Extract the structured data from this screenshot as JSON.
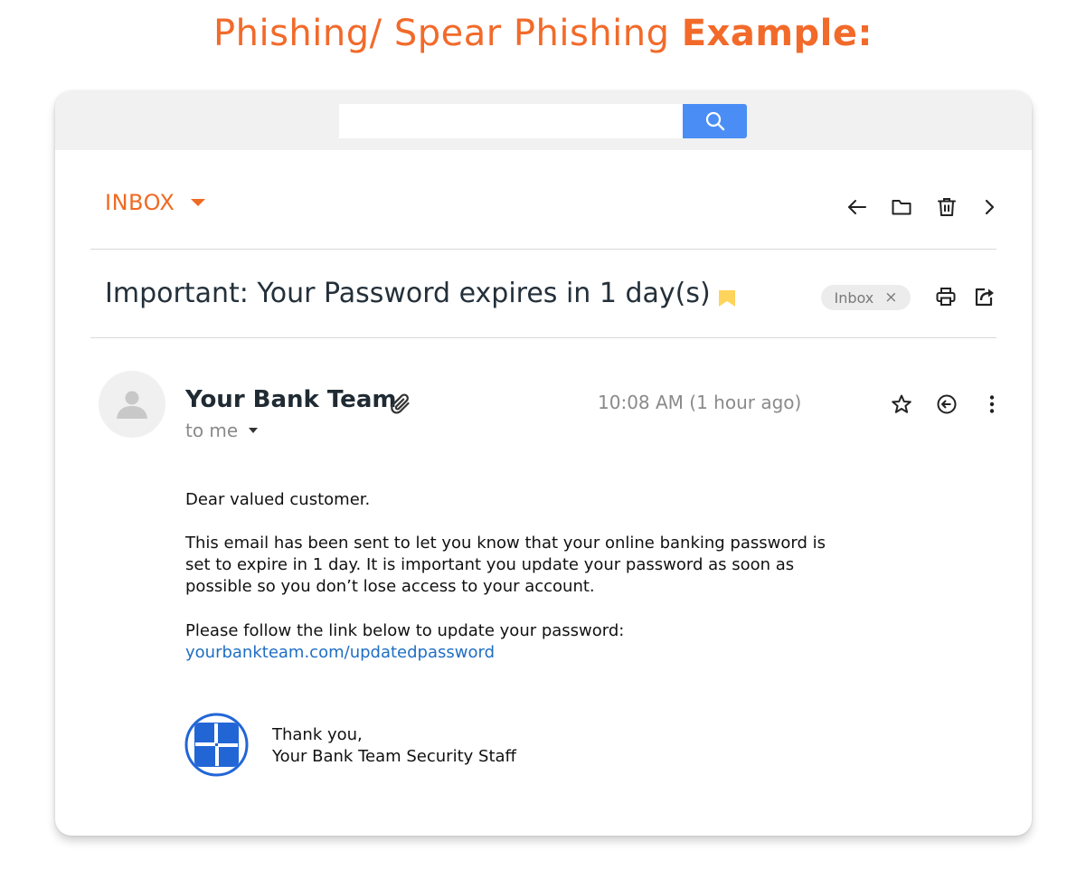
{
  "headline": {
    "regular": "Phishing/ Spear Phishing ",
    "bold": "Example:"
  },
  "search": {
    "value": "",
    "placeholder": ""
  },
  "toolbar": {
    "folder_label": "INBOX"
  },
  "email": {
    "subject": "Important: Your Password expires in 1 day(s)",
    "label": "Inbox",
    "label_close": "×",
    "sender": "Your Bank Team",
    "recipient": "to me",
    "time": "10:08 AM (1 hour ago)",
    "greeting": "Dear valued customer.",
    "paragraph_lines": [
      "This email has been sent to let you know that your online banking password is",
      "set to expire in 1 day. It is important you update your password as soon as",
      "possible so you don’t lose access to your account."
    ],
    "cta": "Please follow the link below to update your password:",
    "link": "yourbankteam.com/updatedpassword",
    "sign_off": "Thank you,",
    "signature": "Your Bank Team Security Staff"
  },
  "icons": [
    "search-icon",
    "back-arrow-icon",
    "folder-icon",
    "trash-icon",
    "chevron-right-icon",
    "bookmark-icon",
    "print-icon",
    "share-icon",
    "avatar-person-icon",
    "paperclip-icon",
    "star-icon",
    "reply-icon",
    "more-vertical-icon",
    "bank-logo"
  ],
  "colors": {
    "accent": "#f26a2a",
    "search_button": "#4a8ef5",
    "link": "#1f6ec4",
    "bookmark": "#ffd45c",
    "logo": "#2266d6"
  }
}
